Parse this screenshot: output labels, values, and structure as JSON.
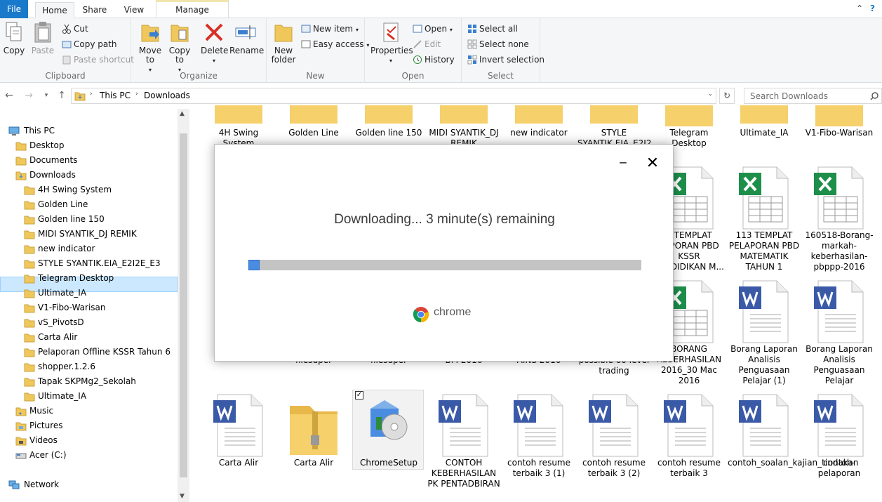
{
  "tabs": {
    "file": "File",
    "home": "Home",
    "share": "Share",
    "view": "View",
    "manage": "Manage"
  },
  "ribbon": {
    "clipboard": {
      "label": "Clipboard",
      "copy": "Copy",
      "paste": "Paste",
      "cut": "Cut",
      "copy_path": "Copy path",
      "paste_shortcut": "Paste shortcut"
    },
    "organize": {
      "label": "Organize",
      "move_to": "Move to",
      "copy_to": "Copy to",
      "delete": "Delete",
      "rename": "Rename"
    },
    "new": {
      "label": "New",
      "new_folder": "New folder",
      "new_item": "New item",
      "easy_access": "Easy access"
    },
    "open": {
      "label": "Open",
      "properties": "Properties",
      "open": "Open",
      "edit": "Edit",
      "history": "History"
    },
    "select": {
      "label": "Select",
      "select_all": "Select all",
      "select_none": "Select none",
      "invert_selection": "Invert selection"
    }
  },
  "address": {
    "this_pc": "This PC",
    "downloads": "Downloads",
    "search_placeholder": "Search Downloads"
  },
  "nav": {
    "items": [
      "This PC",
      "Desktop",
      "Documents",
      "Downloads",
      "4H Swing System",
      "Golden Line",
      "Golden line 150",
      "MIDI SYANTIK_DJ REMIK",
      "new indicator",
      "STYLE SYANTIK.EIA_E2I2E_E3",
      "Telegram Desktop",
      "Ultimate_IA",
      "V1-Fibo-Warisan",
      "vS_PivotsD",
      "Carta Alir",
      "Pelaporan Offline KSSR Tahun 6",
      "shopper.1.2.6",
      "Tapak SKPMg2_Sekolah",
      "Ultimate_IA",
      "Music",
      "Pictures",
      "Videos",
      "Acer (C:)",
      "Network"
    ]
  },
  "files": {
    "row1": [
      "4H Swing System",
      "Golden Line",
      "Golden line 150",
      "MIDI SYANTIK_DJ REMIK",
      "new indicator",
      "STYLE SYANTIK.EIA_E2I2",
      "Telegram Desktop",
      "Ultimate_IA",
      "V1-Fibo-Warisan"
    ],
    "row2": [
      "2 TEMPLAT LAPORAN PBD KSSR PENDIDIKAN M...",
      "113 TEMPLAT PELAPORAN PBD MATEMATIK TAHUN 1",
      "160518-Borang-markah-keberhasilan-pbppp-2016"
    ],
    "row3_partial": [
      "filesuper",
      "filesuper",
      "BM 2016",
      "AINS 2016",
      "possible 60 level trading"
    ],
    "row3": [
      "BORANG KEBERHASILAN 2016_30 Mac 2016",
      "Borang Laporan Analisis Penguasaan Pelajar (1)",
      "Borang Laporan Analisis Penguasaan Pelajar"
    ],
    "row4": [
      "Carta Alir",
      "Carta Alir",
      "ChromeSetup",
      "CONTOH KEBERHASILAN PK PENTADBIRAN",
      "contoh resume terbaik 3 (1)",
      "contoh resume terbaik 3 (2)",
      "contoh resume terbaik 3",
      "contoh_soalan_kajian_tindakan",
      "contoh-pelaporan"
    ]
  },
  "dialog": {
    "message": "Downloading... 3 minute(s) remaining",
    "progress_fraction": 0.02,
    "brand": "chrome"
  },
  "colors": {
    "file_tab": "#1979ca",
    "selection": "#cce8ff",
    "folder": "#f0c75a",
    "excel": "#1d8f4a",
    "word": "#3a5aa8",
    "progress": "#4a8ce0"
  }
}
